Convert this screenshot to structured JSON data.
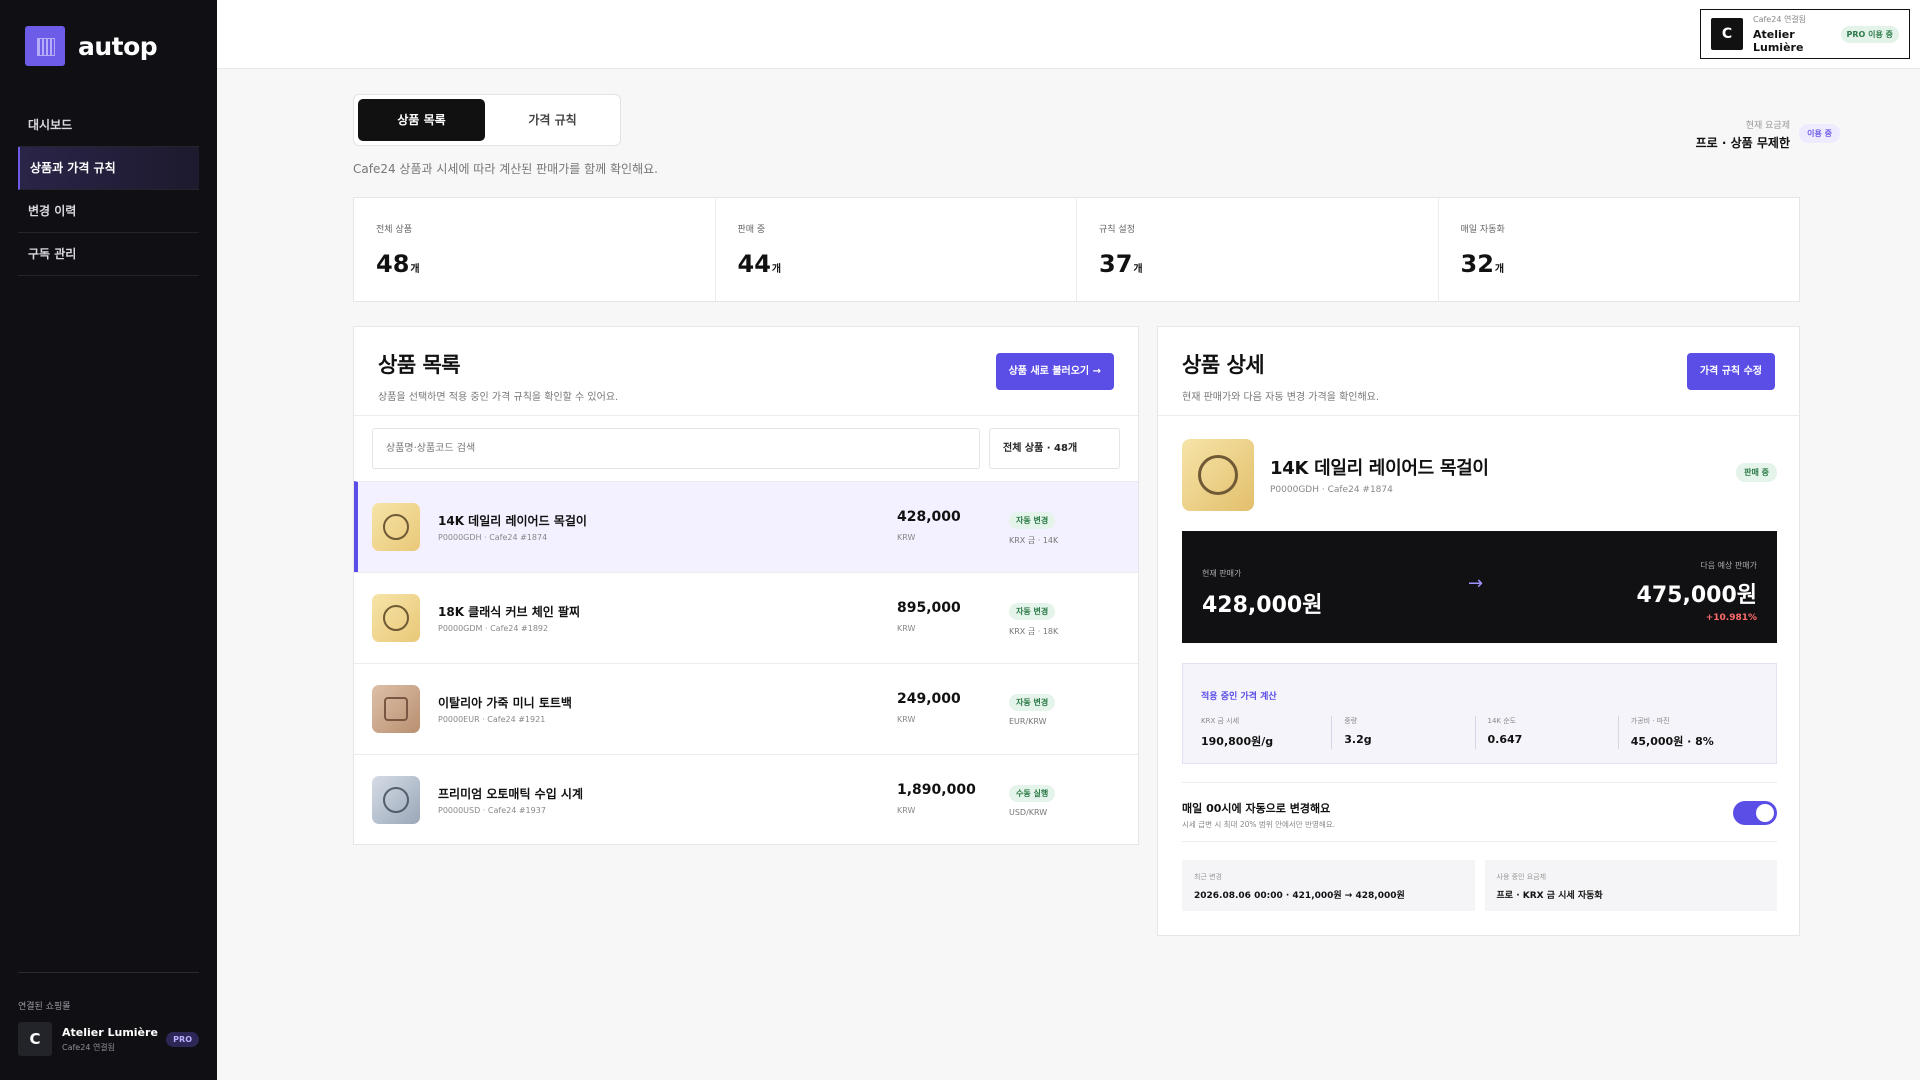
{
  "brand": {
    "name": "autop"
  },
  "sidebar": {
    "items": [
      {
        "label": "대시보드"
      },
      {
        "label": "상품과 가격 규칙"
      },
      {
        "label": "변경 이력"
      },
      {
        "label": "구독 관리"
      }
    ],
    "store_section_label": "연결된 쇼핑몰",
    "store": {
      "avatar": "C",
      "name": "Atelier Lumière",
      "sub": "Cafe24 연결됨",
      "badge": "PRO"
    }
  },
  "header": {
    "account": {
      "avatar": "C",
      "sub": "Cafe24 연결됨",
      "name": "Atelier Lumière",
      "badge": "PRO 이용 중"
    }
  },
  "tabs": [
    {
      "label": "상품 목록"
    },
    {
      "label": "가격 규칙"
    }
  ],
  "page_desc": "Cafe24 상품과 시세에 따라 계산된 판매가를 함께 확인해요.",
  "plan": {
    "label": "현재 요금제",
    "value": "프로 · 상품 무제한",
    "badge": "이용 중"
  },
  "stats": [
    {
      "label": "전체 상품",
      "value": "48",
      "unit": "개"
    },
    {
      "label": "판매 중",
      "value": "44",
      "unit": "개"
    },
    {
      "label": "규칙 설정",
      "value": "37",
      "unit": "개"
    },
    {
      "label": "매일 자동화",
      "value": "32",
      "unit": "개"
    }
  ],
  "list": {
    "title": "상품 목록",
    "sub": "상품을 선택하면 적용 중인 가격 규칙을 확인할 수 있어요.",
    "button": "상품 새로 불러오기 →",
    "search_placeholder": "상품명·상품코드 검색",
    "filter": "전체 상품 · 48개",
    "rows": [
      {
        "name": "14K 데일리 레이어드 목걸이",
        "code": "P0000GDH · Cafe24 #1874",
        "price": "428,000",
        "currency": "KRW",
        "badge": "자동 변경",
        "source": "KRX 금 · 14K"
      },
      {
        "name": "18K 클래식 커브 체인 팔찌",
        "code": "P0000GDM · Cafe24 #1892",
        "price": "895,000",
        "currency": "KRW",
        "badge": "자동 변경",
        "source": "KRX 금 · 18K"
      },
      {
        "name": "이탈리아 가죽 미니 토트백",
        "code": "P0000EUR · Cafe24 #1921",
        "price": "249,000",
        "currency": "KRW",
        "badge": "자동 변경",
        "source": "EUR/KRW"
      },
      {
        "name": "프리미엄 오토매틱 수입 시계",
        "code": "P0000USD · Cafe24 #1937",
        "price": "1,890,000",
        "currency": "KRW",
        "badge": "수동 실행",
        "source": "USD/KRW"
      }
    ]
  },
  "detail": {
    "title": "상품 상세",
    "sub": "현재 판매가와 다음 자동 변경 가격을 확인해요.",
    "button": "가격 규칙 수정",
    "product": {
      "name": "14K 데일리 레이어드 목걸이",
      "code": "P0000GDH · Cafe24 #1874",
      "status": "판매 중"
    },
    "price": {
      "current_label": "현재 판매가",
      "current": "428,000원",
      "arrow": "→",
      "next_label": "다음 예상 판매가",
      "next": "475,000원",
      "change": "+10.981%"
    },
    "calc": {
      "title": "적용 중인 가격 계산",
      "items": [
        {
          "label": "KRX 금 시세",
          "value": "190,800원/g"
        },
        {
          "label": "중량",
          "value": "3.2g"
        },
        {
          "label": "14K 순도",
          "value": "0.647"
        },
        {
          "label": "가공비 · 마진",
          "value": "45,000원 · 8%"
        }
      ]
    },
    "auto": {
      "title": "매일 00시에 자동으로 변경해요",
      "sub": "시세 급변 시 최대 20% 범위 안에서만 반영해요.",
      "enabled": true
    },
    "info": [
      {
        "label": "최근 변경",
        "value": "2026.08.06 00:00 · 421,000원 → 428,000원"
      },
      {
        "label": "사용 중인 요금제",
        "value": "프로 · KRX 금 시세 자동화"
      }
    ]
  },
  "colors": {
    "accent": "#5b4ee6",
    "sidebar": "#101014",
    "positive_change": "#ff6b6b"
  },
  "icons": {
    "arrow": "arrow-right-icon",
    "product_ring": "ring-icon",
    "product_bag": "bag-icon"
  }
}
